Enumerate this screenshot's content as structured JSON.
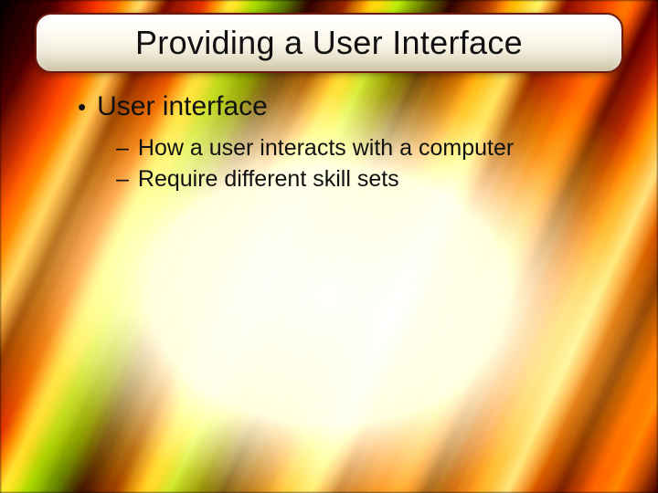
{
  "slide": {
    "title": "Providing a User Interface",
    "bullets": [
      {
        "text": "User interface",
        "subs": [
          "How a user interacts with a computer",
          "Require different skill sets"
        ]
      }
    ]
  }
}
